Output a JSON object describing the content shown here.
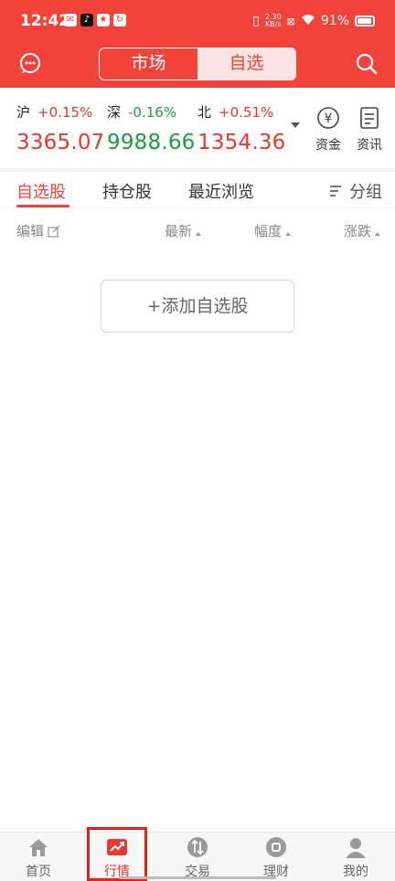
{
  "status_bar": {
    "time": "12:42",
    "net_speed_value": "2.30",
    "net_speed_unit": "KB/s",
    "battery": "91%"
  },
  "header": {
    "tabs": [
      {
        "label": "市场",
        "active": false
      },
      {
        "label": "自选",
        "active": true
      }
    ]
  },
  "indices": [
    {
      "name": "沪",
      "change_pct": "+0.15%",
      "value": "3365.07",
      "trend": "up"
    },
    {
      "name": "深",
      "change_pct": "-0.16%",
      "value": "9988.66",
      "trend": "down"
    },
    {
      "name": "北",
      "change_pct": "+0.51%",
      "value": "1354.36",
      "trend": "up"
    }
  ],
  "tools": [
    {
      "label": "资金",
      "icon": "yuan-circle-icon"
    },
    {
      "label": "资讯",
      "icon": "news-document-icon"
    }
  ],
  "stock_tabs": [
    {
      "label": "自选股",
      "active": true
    },
    {
      "label": "持仓股",
      "active": false
    },
    {
      "label": "最近浏览",
      "active": false
    }
  ],
  "group_label": "分组",
  "columns": {
    "edit": "编辑",
    "latest": "最新",
    "range": "幅度",
    "change": "涨跌"
  },
  "add_button": "+添加自选股",
  "bottom_nav": [
    {
      "label": "首页",
      "icon": "home-icon",
      "active": false
    },
    {
      "label": "行情",
      "icon": "market-chart-icon",
      "active": true
    },
    {
      "label": "交易",
      "icon": "trade-swap-icon",
      "active": false
    },
    {
      "label": "理财",
      "icon": "wealth-icon",
      "active": false
    },
    {
      "label": "我的",
      "icon": "profile-icon",
      "active": false
    }
  ],
  "colors": {
    "brand": "#f2433b",
    "up": "#e8382f",
    "down": "#1f9a45"
  }
}
